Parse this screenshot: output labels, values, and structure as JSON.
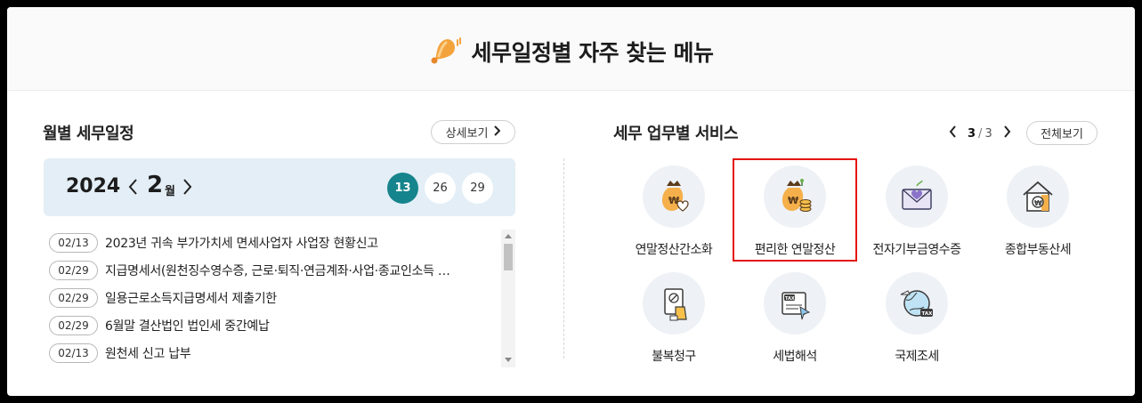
{
  "header": {
    "title": "세무일정별 자주 찾는 메뉴",
    "icon": "bell-icon"
  },
  "monthly": {
    "title": "월별 세무일정",
    "detail_button": "상세보기",
    "year": "2024",
    "month": "2",
    "month_unit": "월",
    "days": [
      {
        "label": "13",
        "selected": true
      },
      {
        "label": "26",
        "selected": false
      },
      {
        "label": "29",
        "selected": false
      }
    ],
    "schedule": [
      {
        "date": "02/13",
        "text": "2023년 귀속 부가가치세 면세사업자 사업장 현황신고"
      },
      {
        "date": "02/29",
        "text": "지급명세서(원천징수영수증, 근로·퇴직·연금계좌·사업·종교인소득 …"
      },
      {
        "date": "02/29",
        "text": "일용근로소득지급명세서 제출기한"
      },
      {
        "date": "02/29",
        "text": "6월말 결산법인 법인세 중간예납"
      },
      {
        "date": "02/13",
        "text": "원천세 신고 납부"
      }
    ]
  },
  "services": {
    "title": "세무 업무별 서비스",
    "page_current": "3",
    "page_sep": "/",
    "page_total": "3",
    "view_all_button": "전체보기",
    "items": [
      {
        "label": "연말정산간소화",
        "icon": "money-bag-heart-icon"
      },
      {
        "label": "편리한 연말정산",
        "icon": "money-bag-coins-icon",
        "highlighted": true
      },
      {
        "label": "전자기부금영수증",
        "icon": "heart-envelope-icon"
      },
      {
        "label": "종합부동산세",
        "icon": "house-won-icon"
      },
      {
        "label": "불복청구",
        "icon": "document-hand-icon"
      },
      {
        "label": "세법해석",
        "icon": "tax-book-icon"
      },
      {
        "label": "국제조세",
        "icon": "globe-tax-icon"
      }
    ]
  },
  "colors": {
    "accent": "#16848c",
    "calendar_bg": "#e3eef6",
    "highlight": "#e3140f"
  }
}
